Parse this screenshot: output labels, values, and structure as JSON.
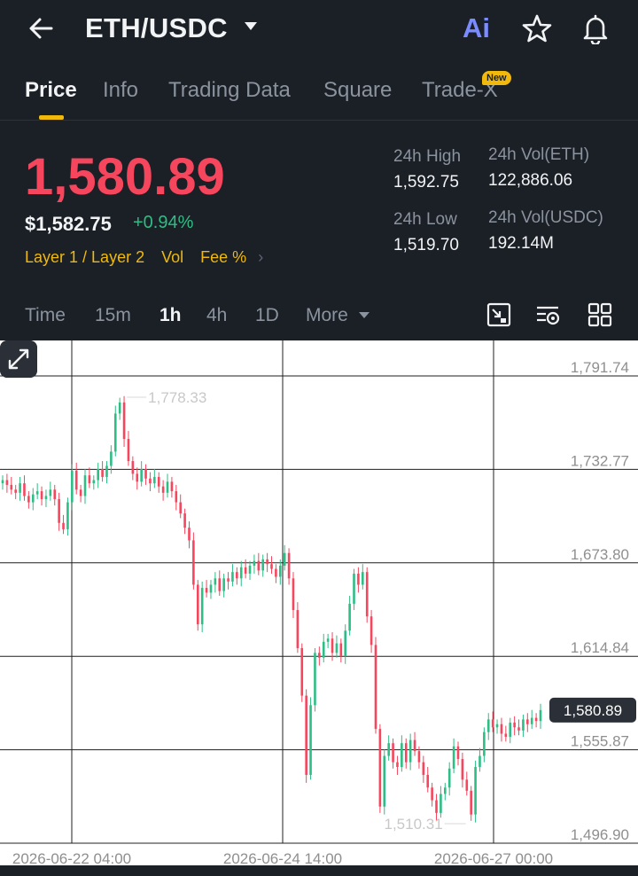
{
  "header": {
    "pair": "ETH/USDC",
    "ai_label": "Ai"
  },
  "tabs": [
    {
      "label": "Price",
      "active": true
    },
    {
      "label": "Info",
      "active": false
    },
    {
      "label": "Trading Data",
      "active": false
    },
    {
      "label": "Square",
      "active": false
    },
    {
      "label": "Trade-X",
      "active": false
    }
  ],
  "new_badge": "New",
  "ticker": {
    "last_price": "1,580.89",
    "usd_price": "$1,582.75",
    "change_pct": "+0.94%",
    "tags": [
      "Layer 1 / Layer 2",
      "Vol",
      "Fee %"
    ],
    "high_label": "24h High",
    "high_value": "1,592.75",
    "low_label": "24h Low",
    "low_value": "1,519.70",
    "vol_base_label": "24h Vol(ETH)",
    "vol_base_value": "122,886.06",
    "vol_quote_label": "24h Vol(USDC)",
    "vol_quote_value": "192.14M"
  },
  "intervals": [
    {
      "label": "Time",
      "active": false
    },
    {
      "label": "15m",
      "active": false
    },
    {
      "label": "1h",
      "active": true
    },
    {
      "label": "4h",
      "active": false
    },
    {
      "label": "1D",
      "active": false
    },
    {
      "label": "More",
      "active": false
    }
  ],
  "colors": {
    "up": "#2ebd85",
    "down": "#f6465d",
    "accent": "#f0b90b",
    "background": "#1b1f26"
  },
  "chart_data": {
    "type": "candlestick",
    "y_ticks": [
      "1,791.74",
      "1,732.77",
      "1,673.80",
      "1,614.84",
      "1,555.87",
      "1,496.90"
    ],
    "x_ticks": [
      "2026-06-22 04:00",
      "2026-06-24 14:00",
      "2026-06-27 00:00"
    ],
    "ylim": [
      1496.9,
      1791.74
    ],
    "max_label": "1,778.33",
    "min_label": "1,510.31",
    "last_price_label": "1,580.89",
    "grid": true,
    "close_series": [
      1726,
      1723,
      1720,
      1718,
      1724,
      1716,
      1712,
      1717,
      1719,
      1714,
      1716,
      1720,
      1714,
      1699,
      1695,
      1712,
      1732,
      1720,
      1716,
      1729,
      1724,
      1726,
      1733,
      1728,
      1735,
      1744,
      1768,
      1775,
      1752,
      1738,
      1730,
      1725,
      1733,
      1727,
      1724,
      1728,
      1722,
      1718,
      1725,
      1719,
      1712,
      1705,
      1696,
      1688,
      1660,
      1635,
      1658,
      1655,
      1660,
      1664,
      1656,
      1664,
      1662,
      1668,
      1664,
      1671,
      1667,
      1672,
      1675,
      1669,
      1676,
      1673,
      1670,
      1665,
      1672,
      1680,
      1664,
      1644,
      1620,
      1590,
      1540,
      1584,
      1617,
      1614,
      1624,
      1626,
      1617,
      1623,
      1615,
      1631,
      1648,
      1667,
      1660,
      1668,
      1640,
      1622,
      1569,
      1520,
      1552,
      1560,
      1548,
      1545,
      1560,
      1548,
      1562,
      1555,
      1548,
      1540,
      1532,
      1524,
      1516,
      1528,
      1532,
      1544,
      1558,
      1550,
      1537,
      1530,
      1515,
      1545,
      1552,
      1567,
      1575,
      1570,
      1572,
      1566,
      1564,
      1573,
      1570,
      1568,
      1575,
      1572,
      1576,
      1574,
      1580.89
    ]
  }
}
